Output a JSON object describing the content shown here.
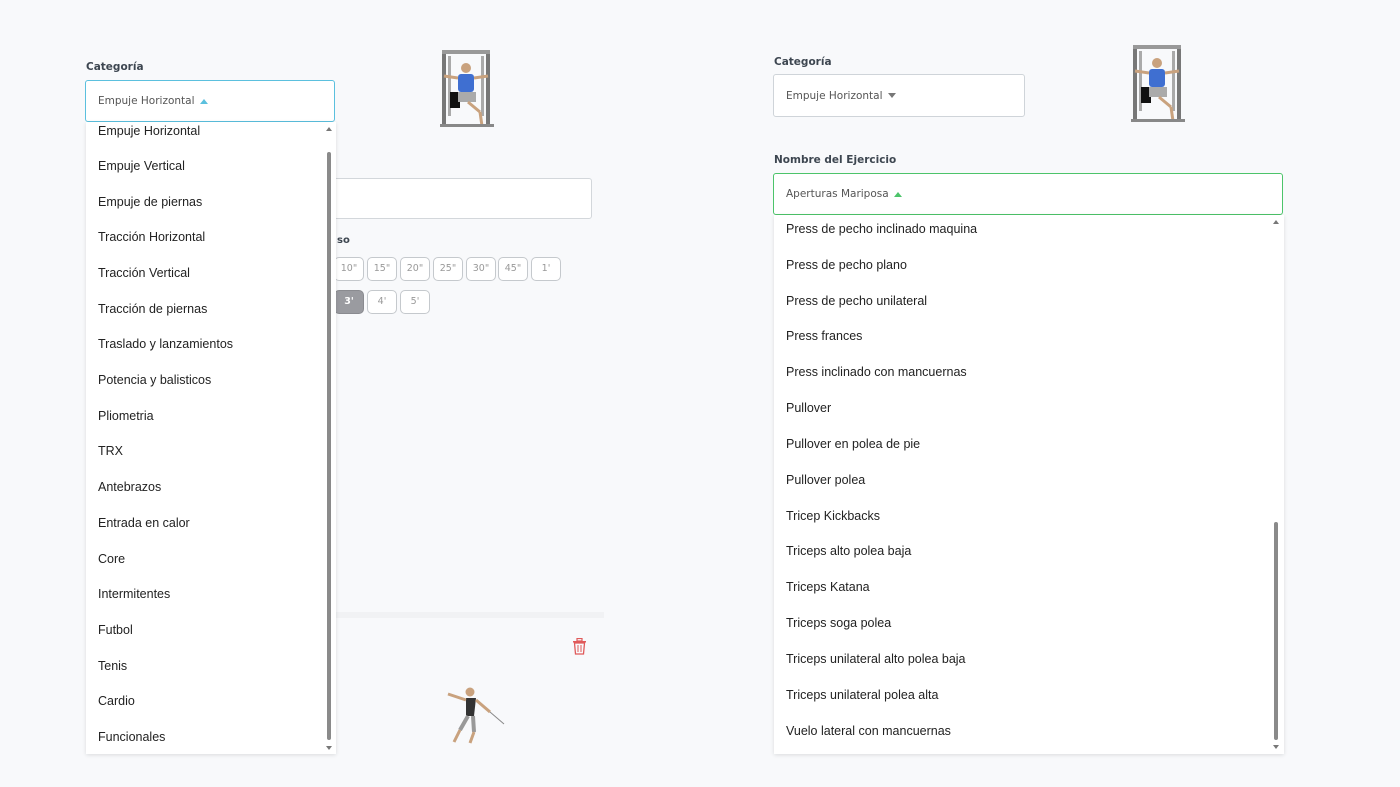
{
  "left_panel": {
    "category_label": "Categoría",
    "category_value": "Empuje Horizontal",
    "partial_label": "so",
    "row1_chips": [
      "10\"",
      "15\"",
      "20\"",
      "25\"",
      "30\"",
      "45\"",
      "1'"
    ],
    "row2_chips": [
      "3'",
      "4'",
      "5'"
    ],
    "selected_chip": "3'",
    "dropdown_items": [
      "Empuje Horizontal",
      "Empuje Vertical",
      "Empuje de piernas",
      "Tracción Horizontal",
      "Tracción Vertical",
      "Tracción de piernas",
      "Traslado y lanzamientos",
      "Potencia y balisticos",
      "Pliometria",
      "TRX",
      "Antebrazos",
      "Entrada en calor",
      "Core",
      "Intermitentes",
      "Futbol",
      "Tenis",
      "Cardio",
      "Funcionales"
    ],
    "accent_color": "#5bc0de",
    "delete_icon_color": "#e05a5a"
  },
  "right_panel": {
    "category_label": "Categoría",
    "category_value": "Empuje Horizontal",
    "exercise_label": "Nombre del Ejercicio",
    "exercise_value": "Aperturas Mariposa",
    "dropdown_items": [
      "Press de pecho inclinado maquina",
      "Press de pecho plano",
      "Press de pecho unilateral",
      "Press frances",
      "Press inclinado con mancuernas",
      "Pullover",
      "Pullover en polea de pie",
      "Pullover polea",
      "Tricep Kickbacks",
      "Triceps alto polea baja",
      "Triceps Katana",
      "Triceps soga polea",
      "Triceps unilateral alto polea baja",
      "Triceps unilateral polea alta",
      "Vuelo lateral con mancuernas"
    ],
    "accent_color": "#4cc46a"
  }
}
